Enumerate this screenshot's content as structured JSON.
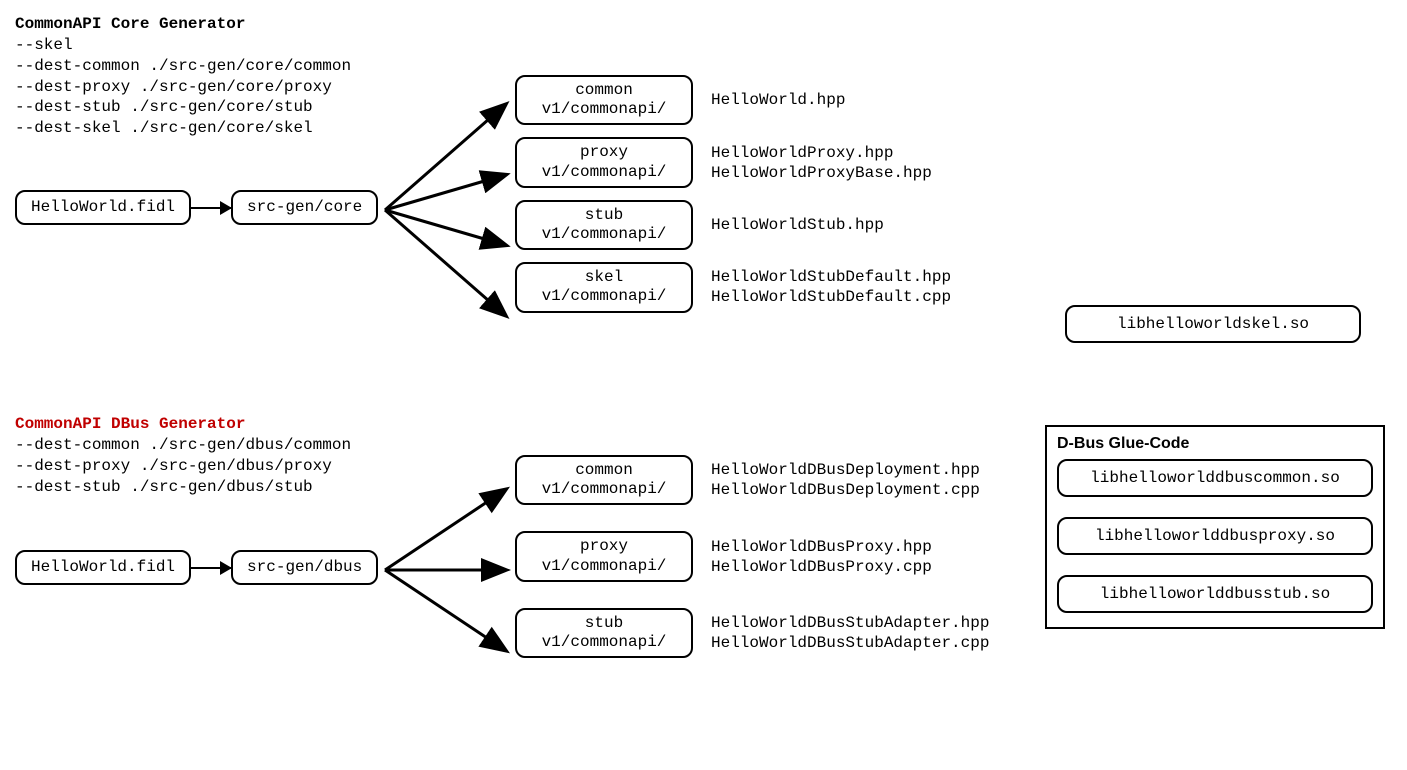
{
  "core": {
    "title": "CommonAPI Core Generator",
    "options": "--skel\n--dest-common ./src-gen/core/common\n--dest-proxy ./src-gen/core/proxy\n--dest-stub ./src-gen/core/stub\n--dest-skel ./src-gen/core/skel",
    "input": "HelloWorld.fidl",
    "srcgen": "src-gen/core",
    "branches": [
      {
        "name": "common",
        "sub": "v1/commonapi/",
        "files": "HelloWorld.hpp"
      },
      {
        "name": "proxy",
        "sub": "v1/commonapi/",
        "files": "HelloWorldProxy.hpp\nHelloWorldProxyBase.hpp"
      },
      {
        "name": "stub",
        "sub": "v1/commonapi/",
        "files": "HelloWorldStub.hpp"
      },
      {
        "name": "skel",
        "sub": "v1/commonapi/",
        "files": "HelloWorldStubDefault.hpp\nHelloWorldStubDefault.cpp"
      }
    ],
    "skel_lib": "libhelloworldskel.so"
  },
  "dbus": {
    "title": "CommonAPI DBus Generator",
    "options": "--dest-common ./src-gen/dbus/common\n--dest-proxy ./src-gen/dbus/proxy\n--dest-stub ./src-gen/dbus/stub",
    "input": "HelloWorld.fidl",
    "srcgen": "src-gen/dbus",
    "branches": [
      {
        "name": "common",
        "sub": "v1/commonapi/",
        "files": "HelloWorldDBusDeployment.hpp\nHelloWorldDBusDeployment.cpp"
      },
      {
        "name": "proxy",
        "sub": "v1/commonapi/",
        "files": "HelloWorldDBusProxy.hpp\nHelloWorldDBusProxy.cpp"
      },
      {
        "name": "stub",
        "sub": "v1/commonapi/",
        "files": "HelloWorldDBusStubAdapter.hpp\nHelloWorldDBusStubAdapter.cpp"
      }
    ],
    "glue": {
      "title": "D-Bus Glue-Code",
      "libs": [
        "libhelloworlddbuscommon.so",
        "libhelloworlddbusproxy.so",
        "libhelloworlddbusstub.so"
      ]
    }
  }
}
